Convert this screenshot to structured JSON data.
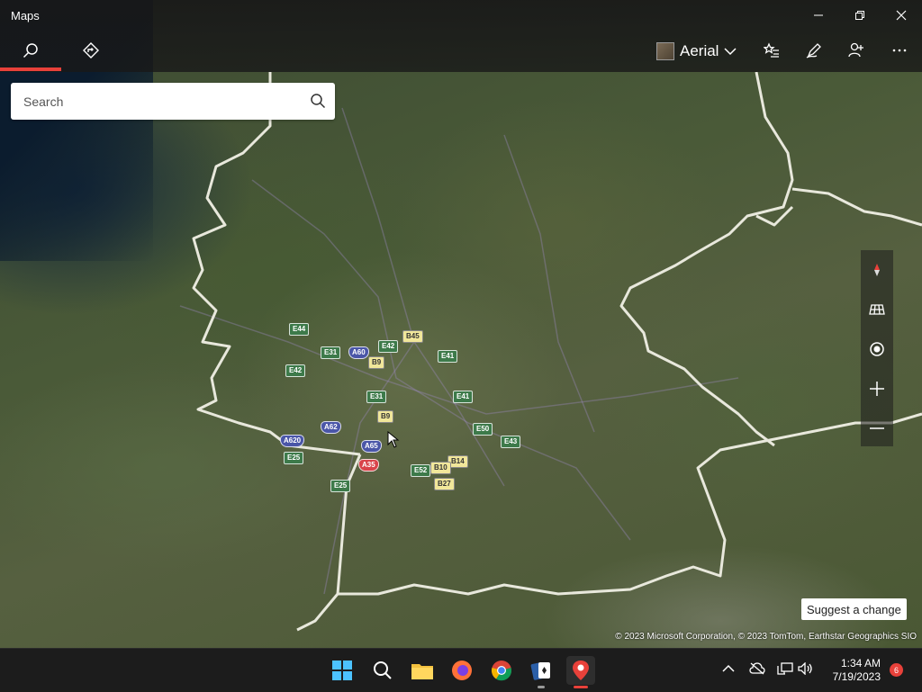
{
  "app": {
    "title": "Maps"
  },
  "toolbar": {
    "map_style_label": "Aerial"
  },
  "search": {
    "placeholder": "Search"
  },
  "map": {
    "road_shields": [
      {
        "label": "E44",
        "color": "green"
      },
      {
        "label": "E31",
        "color": "green"
      },
      {
        "label": "A60",
        "color": "blue"
      },
      {
        "label": "E42",
        "color": "green"
      },
      {
        "label": "B45",
        "color": "yellow"
      },
      {
        "label": "B9",
        "color": "yellow"
      },
      {
        "label": "E42",
        "color": "green"
      },
      {
        "label": "E41",
        "color": "green"
      },
      {
        "label": "E31",
        "color": "green"
      },
      {
        "label": "E41",
        "color": "green"
      },
      {
        "label": "B9",
        "color": "yellow"
      },
      {
        "label": "A62",
        "color": "blue"
      },
      {
        "label": "E50",
        "color": "green"
      },
      {
        "label": "A620",
        "color": "blue"
      },
      {
        "label": "A65",
        "color": "blue"
      },
      {
        "label": "E43",
        "color": "green"
      },
      {
        "label": "E25",
        "color": "green"
      },
      {
        "label": "A35",
        "color": "red"
      },
      {
        "label": "B14",
        "color": "yellow"
      },
      {
        "label": "E52",
        "color": "green"
      },
      {
        "label": "B10",
        "color": "yellow"
      },
      {
        "label": "B27",
        "color": "yellow"
      },
      {
        "label": "E25",
        "color": "green"
      }
    ],
    "suggest_label": "Suggest a change",
    "attribution": "© 2023 Microsoft Corporation, © 2023 TomTom, Earthstar Geographics  SIO"
  },
  "taskbar": {
    "time": "1:34 AM",
    "date": "7/19/2023",
    "notification_count": "6"
  },
  "colors": {
    "accent": "#e8413a",
    "titlebar": "#181818",
    "taskbar": "#1c1c1c"
  }
}
